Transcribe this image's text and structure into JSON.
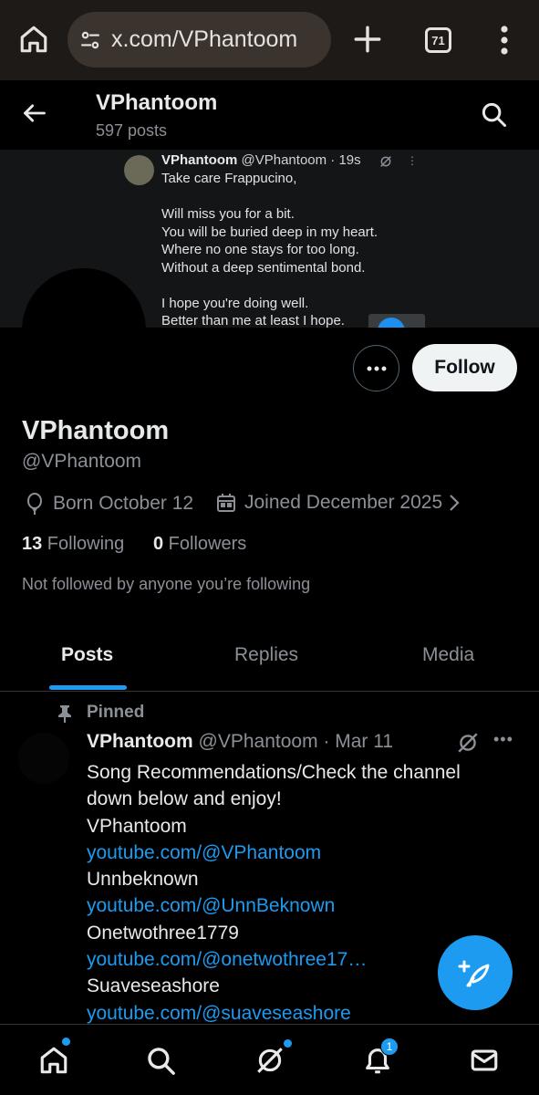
{
  "browser": {
    "url": "x.com/VPhantoom",
    "tab_count": "71"
  },
  "header": {
    "name": "VPhantoom",
    "post_count": "597 posts"
  },
  "banner": {
    "author_name": "VPhantoom",
    "author_meta": "@VPhantoom · 19s",
    "dots": "⋮",
    "lines": [
      "Take care Frappucino,",
      "",
      "Will miss you for a bit.",
      "You will be buried deep in my heart.",
      "Where no one stays for too long.",
      "Without a deep sentimental bond.",
      "",
      "I hope you're doing well.",
      "Better than me at least I hope."
    ]
  },
  "profile": {
    "follow_label": "Follow",
    "name": "VPhantoom",
    "handle": "@VPhantoom",
    "born": "Born October 12",
    "joined": "Joined December 2025",
    "following_count": "13",
    "following_label": " Following",
    "followers_count": "0",
    "followers_label": " Followers",
    "not_followed": "Not followed by anyone you’re following"
  },
  "tabs": {
    "posts": "Posts",
    "replies": "Replies",
    "media": "Media"
  },
  "post": {
    "pinned_label": "Pinned",
    "author_name": "VPhantoom",
    "author_meta": " @VPhantoom · Mar 11",
    "more": "•••",
    "lines": [
      {
        "text": "Song Recommendations/Check the channel",
        "link": false
      },
      {
        "text": "down below and enjoy!",
        "link": false
      },
      {
        "text": "VPhantoom",
        "link": false
      },
      {
        "text": "youtube.com/@VPhantoom",
        "link": true
      },
      {
        "text": "Unnbeknown",
        "link": false
      },
      {
        "text": "youtube.com/@UnnBeknown",
        "link": true
      },
      {
        "text": "Onetwothree1779",
        "link": false
      },
      {
        "text": "youtube.com/@onetwothree17…",
        "link": true
      },
      {
        "text": "Suaveseashore",
        "link": false
      },
      {
        "text": "youtube.com/@suaveseashore",
        "link": true
      }
    ]
  },
  "bottom_nav": {
    "notification_badge": "1"
  },
  "colors": {
    "accent": "#1d9bf0",
    "background": "#000000",
    "secondary_text": "#8b9096"
  }
}
